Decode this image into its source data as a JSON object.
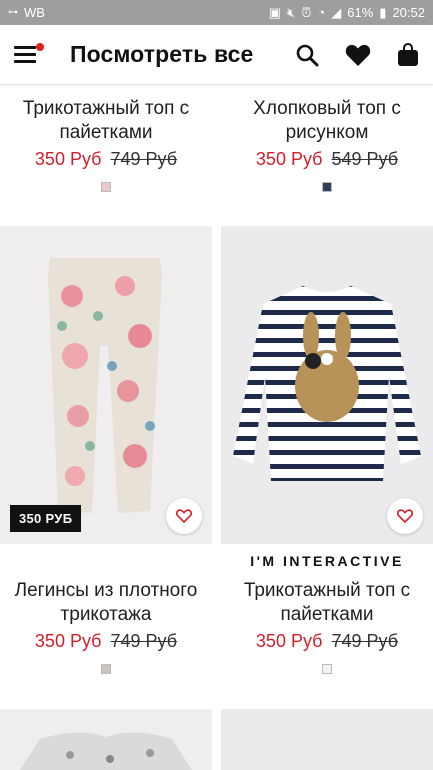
{
  "status_bar": {
    "carrier": "WB",
    "battery": "61%",
    "time": "20:52"
  },
  "header": {
    "title": "Посмотреть все",
    "icons": [
      "menu-icon",
      "search-icon",
      "heart-icon",
      "bag-icon"
    ]
  },
  "products": [
    {
      "name": "Трикотажный топ с пайетками",
      "price_new": "350 Руб",
      "price_old": "749 Руб",
      "swatch_color": "#e9c9cc"
    },
    {
      "name": "Хлопковый топ с рисунком",
      "price_new": "350 Руб",
      "price_old": "549 Руб",
      "swatch_color": "#2f3f55"
    },
    {
      "name": "Легинсы из плотного трикотажа",
      "price_new": "350 Руб",
      "price_old": "749 Руб",
      "swatch_color": "#c9c5bc",
      "badge": "350 РУБ"
    },
    {
      "name": "Трикотажный топ с пайетками",
      "price_new": "350 Руб",
      "price_old": "749 Руб",
      "swatch_color": "#f2f2f2",
      "label": "I'M INTERACTIVE"
    }
  ],
  "colors": {
    "accent_red": "#d0212b",
    "badge_black": "#111111",
    "status_bar": "#9e9e9e"
  }
}
